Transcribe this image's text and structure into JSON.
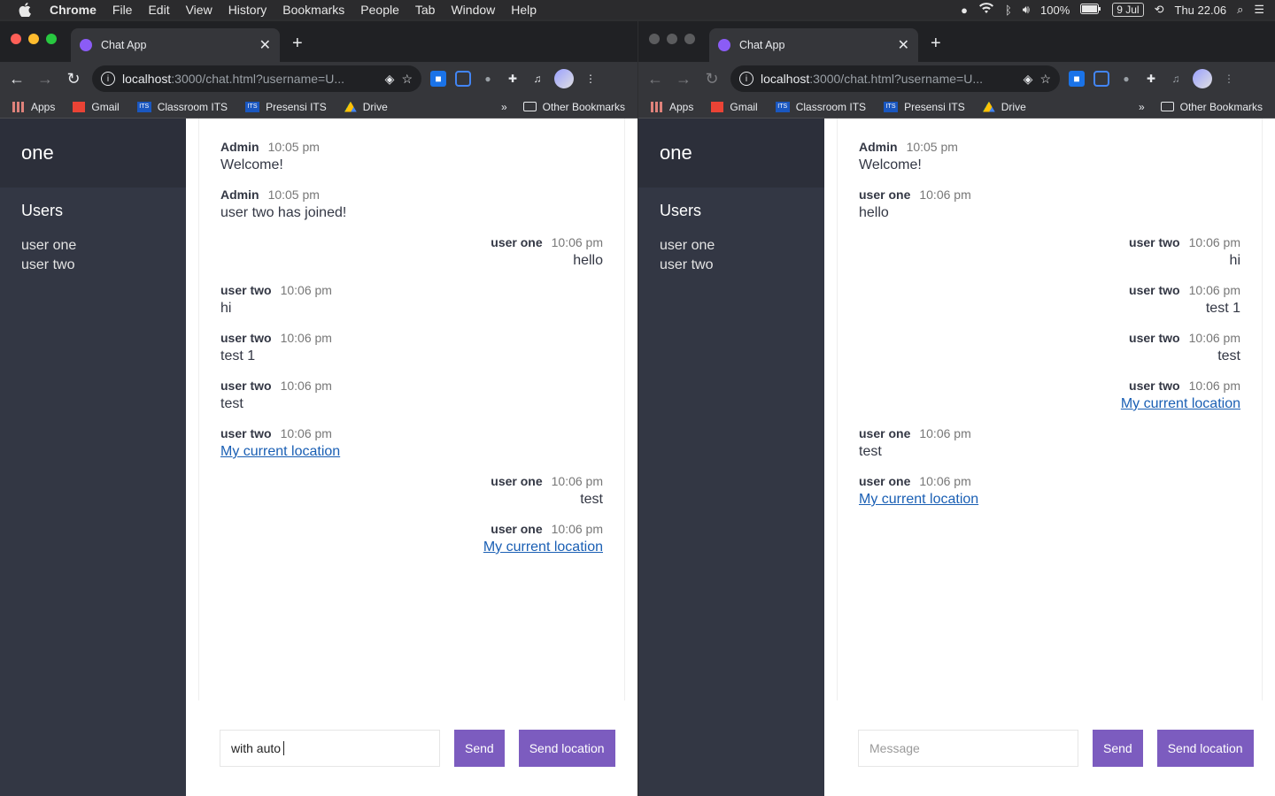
{
  "menubar": {
    "app": "Chrome",
    "items": [
      "File",
      "Edit",
      "View",
      "History",
      "Bookmarks",
      "People",
      "Tab",
      "Window",
      "Help"
    ],
    "battery": "100%",
    "date_badge": "9 Jul",
    "clock": "Thu 22.06"
  },
  "browser": {
    "tab_title": "Chat App",
    "url_host": "localhost",
    "url_path": ":3000/chat.html?username=U...",
    "bookmarks": [
      "Apps",
      "Gmail",
      "Classroom ITS",
      "Presensi ITS",
      "Drive"
    ],
    "other_bookmarks": "Other Bookmarks"
  },
  "left": {
    "room": "one",
    "users_title": "Users",
    "users": [
      "user one",
      "user two"
    ],
    "messages": [
      {
        "name": "Admin",
        "time": "10:05 pm",
        "text": "Welcome!",
        "mine": false,
        "link": false
      },
      {
        "name": "Admin",
        "time": "10:05 pm",
        "text": "user two has joined!",
        "mine": false,
        "link": false
      },
      {
        "name": "user one",
        "time": "10:06 pm",
        "text": "hello",
        "mine": true,
        "link": false
      },
      {
        "name": "user two",
        "time": "10:06 pm",
        "text": "hi",
        "mine": false,
        "link": false
      },
      {
        "name": "user two",
        "time": "10:06 pm",
        "text": "test 1",
        "mine": false,
        "link": false
      },
      {
        "name": "user two",
        "time": "10:06 pm",
        "text": "test",
        "mine": false,
        "link": false
      },
      {
        "name": "user two",
        "time": "10:06 pm",
        "text": "My current location",
        "mine": false,
        "link": true
      },
      {
        "name": "user one",
        "time": "10:06 pm",
        "text": "test",
        "mine": true,
        "link": false
      },
      {
        "name": "user one",
        "time": "10:06 pm",
        "text": "My current location",
        "mine": true,
        "link": true
      }
    ],
    "input_value": "with auto ",
    "send_label": "Send",
    "location_label": "Send location"
  },
  "right": {
    "room": "one",
    "users_title": "Users",
    "users": [
      "user one",
      "user two"
    ],
    "messages": [
      {
        "name": "Admin",
        "time": "10:05 pm",
        "text": "Welcome!",
        "mine": false,
        "link": false
      },
      {
        "name": "user one",
        "time": "10:06 pm",
        "text": "hello",
        "mine": false,
        "link": false
      },
      {
        "name": "user two",
        "time": "10:06 pm",
        "text": "hi",
        "mine": true,
        "link": false
      },
      {
        "name": "user two",
        "time": "10:06 pm",
        "text": "test 1",
        "mine": true,
        "link": false
      },
      {
        "name": "user two",
        "time": "10:06 pm",
        "text": "test",
        "mine": true,
        "link": false
      },
      {
        "name": "user two",
        "time": "10:06 pm",
        "text": "My current location",
        "mine": true,
        "link": true
      },
      {
        "name": "user one",
        "time": "10:06 pm",
        "text": "test",
        "mine": false,
        "link": false
      },
      {
        "name": "user one",
        "time": "10:06 pm",
        "text": "My current location",
        "mine": false,
        "link": true
      }
    ],
    "input_placeholder": "Message",
    "send_label": "Send",
    "location_label": "Send location"
  }
}
